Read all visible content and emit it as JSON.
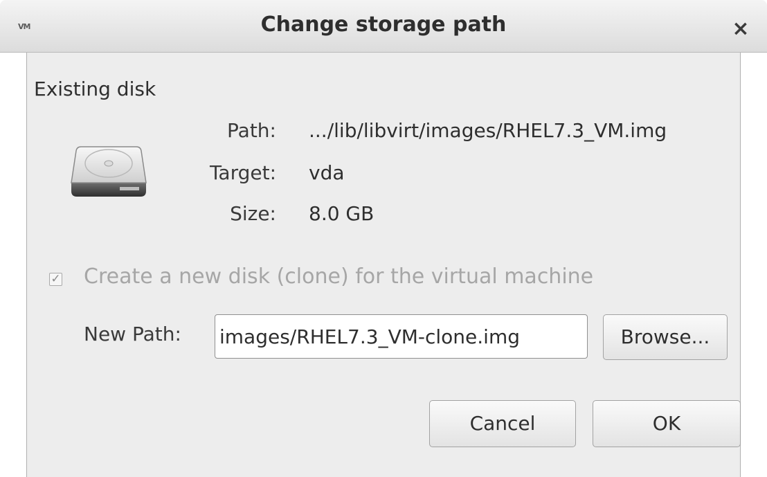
{
  "window": {
    "title": "Change storage path",
    "app_icon_text": "VM",
    "close_glyph": "×",
    "icons": [
      "vm-app-icon",
      "close-icon",
      "hard-disk-icon",
      "check-icon"
    ]
  },
  "existing_disk": {
    "heading": "Existing disk",
    "path_label": "Path:",
    "path_value": ".../lib/libvirt/images/RHEL7.3_VM.img",
    "target_label": "Target:",
    "target_value": "vda",
    "size_label": "Size:",
    "size_value": "8.0 GB"
  },
  "clone": {
    "checkbox_label": "Create a new disk (clone) for the virtual machine",
    "checked": true,
    "check_glyph": "✓",
    "new_path_label": "New Path:",
    "new_path_value": "images/RHEL7.3_VM-clone.img",
    "browse_label": "Browse..."
  },
  "buttons": {
    "cancel": "Cancel",
    "ok": "OK"
  }
}
